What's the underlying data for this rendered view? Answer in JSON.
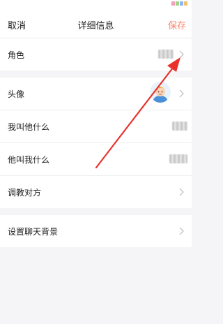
{
  "nav": {
    "cancel": "取消",
    "title": "详细信息",
    "save": "保存"
  },
  "rows": {
    "role": "角色",
    "avatar": "头像",
    "i_call_him": "我叫他什么",
    "he_calls_me": "他叫我什么",
    "train": "调教对方",
    "chat_bg": "设置聊天背景"
  },
  "colors": {
    "accent": "#f2866a",
    "annotation_arrow": "#e8322b"
  }
}
